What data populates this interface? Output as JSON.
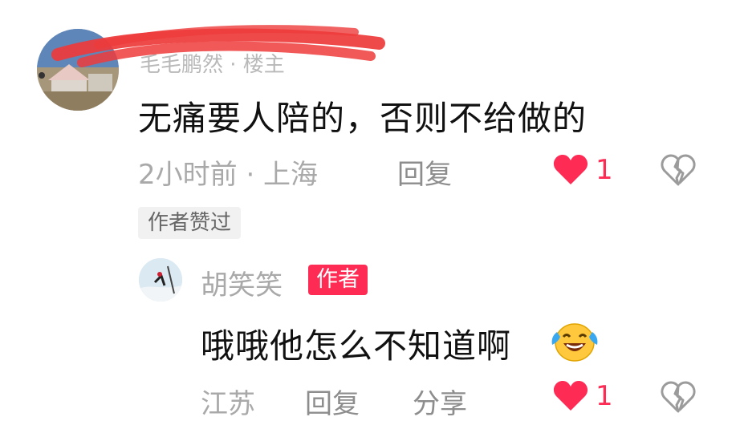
{
  "comment": {
    "username": "毛毛鹏然 · 楼主",
    "text": "无痛要人陪的，否则不给做的",
    "time_location": "2小时前 · 上海",
    "reply_label": "回复",
    "like_count": "1",
    "author_liked_badge": "作者赞过",
    "icons": {
      "like": "heart-icon-filled",
      "dislike": "broken-heart-icon"
    },
    "colors": {
      "like": "#fe2c55",
      "redaction": "#ee3b3b"
    }
  },
  "reply": {
    "username": "胡笑笑",
    "author_badge": "作者",
    "text": "哦哦他怎么不知道啊",
    "emoji": "laughing-crying-emoji",
    "location": "江苏",
    "reply_label": "回复",
    "share_label": "分享",
    "like_count": "1"
  }
}
